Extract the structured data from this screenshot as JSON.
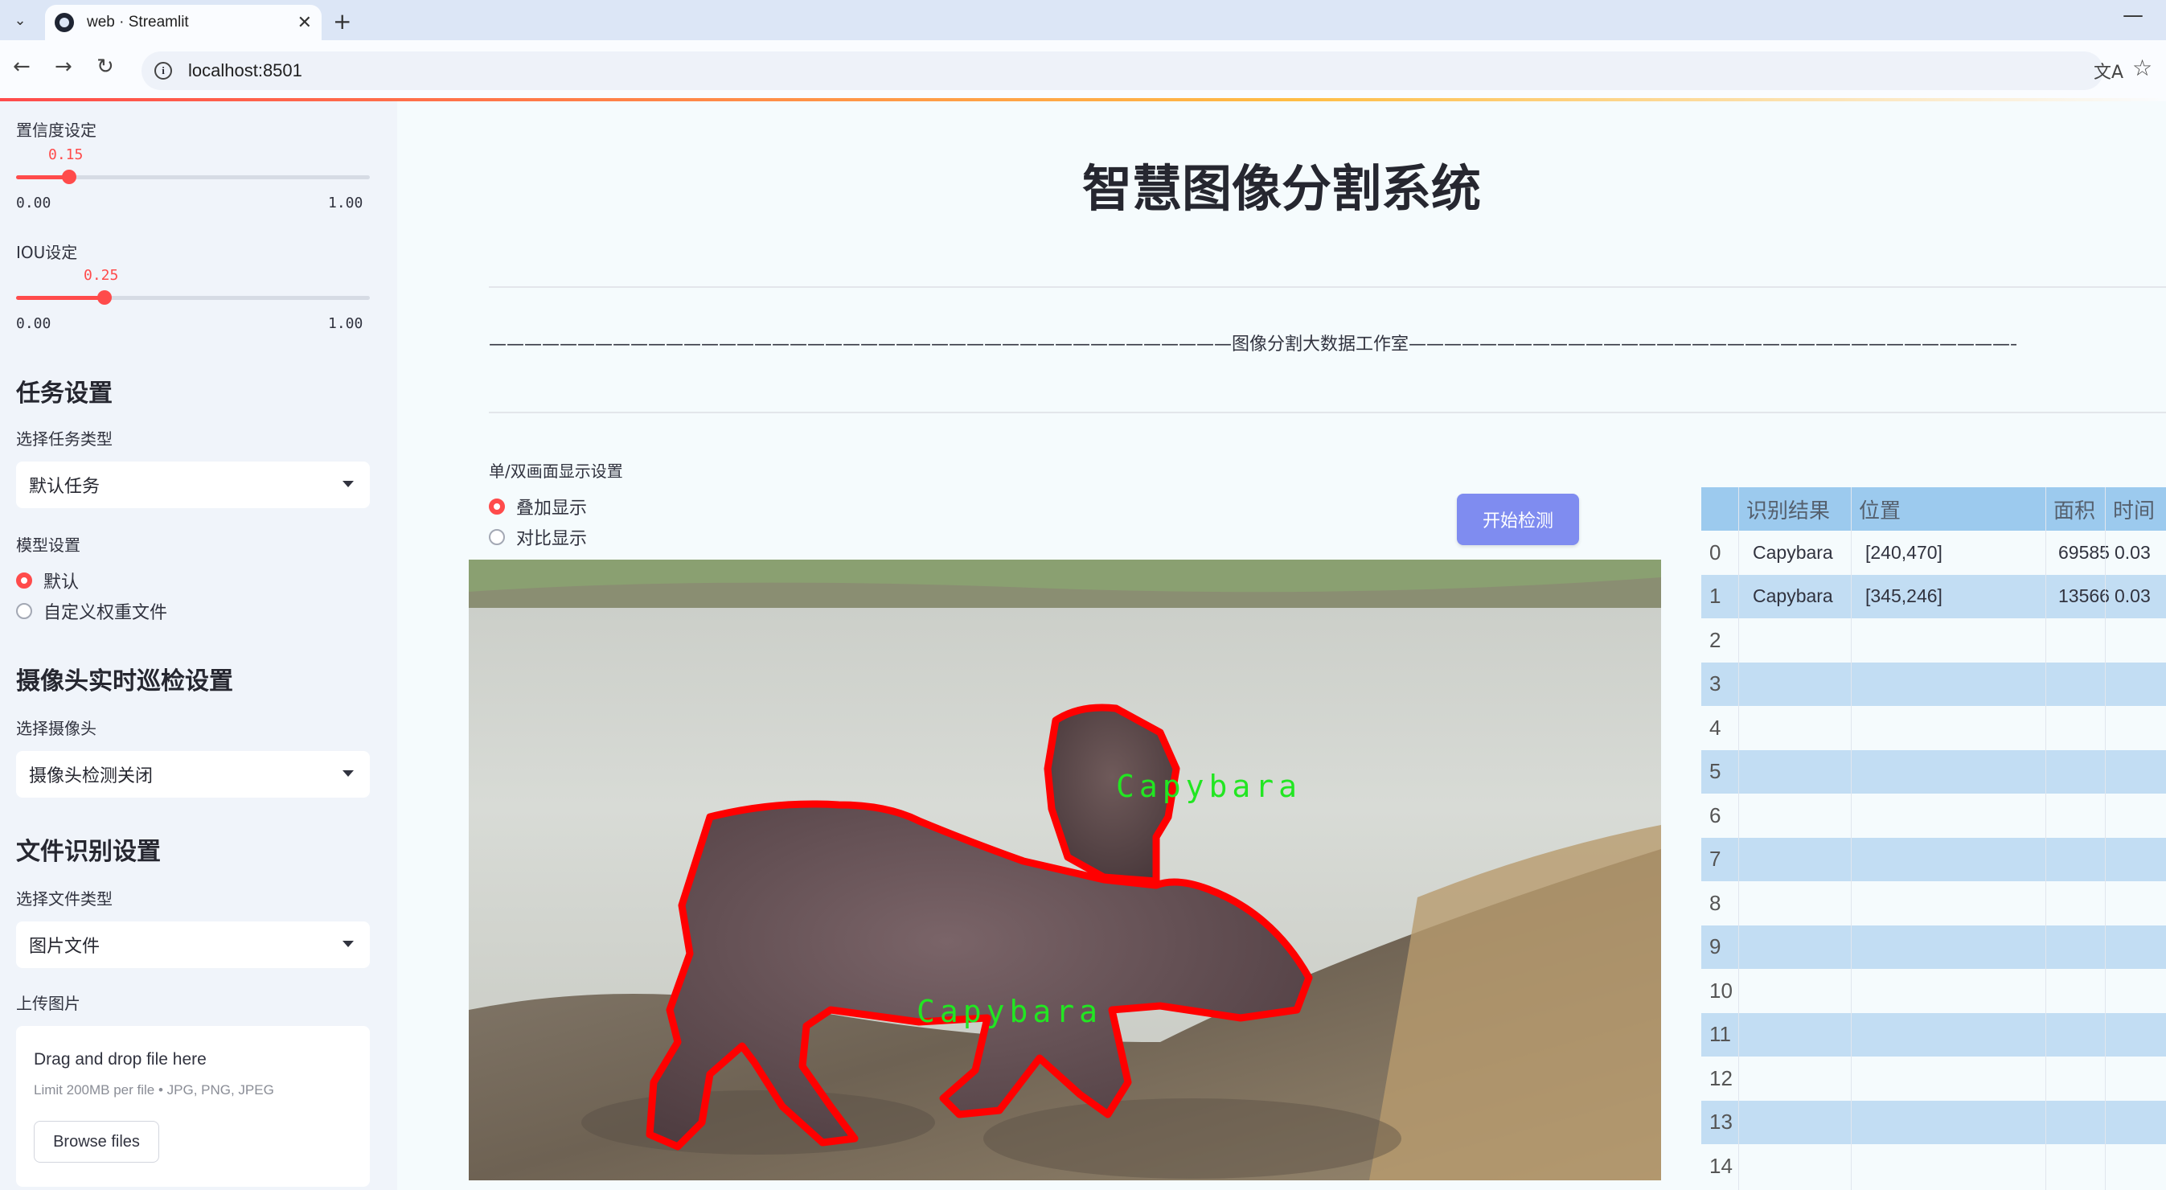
{
  "browser": {
    "tab_title": "web · Streamlit",
    "url": "localhost:8501"
  },
  "sidebar": {
    "confidence": {
      "label": "置信度设定",
      "value": "0.15",
      "fraction": 0.15,
      "min": "0.00",
      "max": "1.00"
    },
    "iou": {
      "label": "IOU设定",
      "value": "0.25",
      "fraction": 0.25,
      "min": "0.00",
      "max": "1.00"
    },
    "task_heading": "任务设置",
    "task_type_label": "选择任务类型",
    "task_type_value": "默认任务",
    "model_label": "模型设置",
    "model_options": [
      "默认",
      "自定义权重文件"
    ],
    "model_selected": 0,
    "camera_heading": "摄像头实时巡检设置",
    "camera_label": "选择摄像头",
    "camera_value": "摄像头检测关闭",
    "file_heading": "文件识别设置",
    "file_type_label": "选择文件类型",
    "file_type_value": "图片文件",
    "upload_label": "上传图片",
    "uploader": {
      "drag_text": "Drag and drop file here",
      "limit_text": "Limit 200MB per file • JPG, PNG, JPEG",
      "button": "Browse files"
    }
  },
  "main": {
    "title": "智慧图像分割系统",
    "divider_text": "——————————————————————————————————————————图像分割大数据工作室——————————————————————————————————————————",
    "display_label": "单/双画面显示设置",
    "display_options": [
      "叠加显示",
      "对比显示"
    ],
    "display_selected": 0,
    "run_button": "开始检测",
    "detections": [
      {
        "label": "Capybara"
      },
      {
        "label": "Capybara"
      }
    ]
  },
  "table": {
    "columns": [
      "识别结果",
      "位置",
      "面积",
      "时间"
    ],
    "rows": [
      {
        "index": "0",
        "result": "Capybara",
        "position": "[240,470]",
        "area": "69585",
        "time": "0.03"
      },
      {
        "index": "1",
        "result": "Capybara",
        "position": "[345,246]",
        "area": "13566",
        "time": "0.03"
      },
      {
        "index": "2"
      },
      {
        "index": "3"
      },
      {
        "index": "4"
      },
      {
        "index": "5"
      },
      {
        "index": "6"
      },
      {
        "index": "7"
      },
      {
        "index": "8"
      },
      {
        "index": "9"
      },
      {
        "index": "10"
      },
      {
        "index": "11"
      },
      {
        "index": "12"
      },
      {
        "index": "13"
      },
      {
        "index": "14"
      }
    ]
  },
  "colors": {
    "accent": "#ff4b4b",
    "button": "#7f8cf0",
    "table_header": "#9ccaee",
    "table_alt_row": "#c2ddf3",
    "mask_outline": "#ff0000",
    "mask_label": "#22e622"
  }
}
